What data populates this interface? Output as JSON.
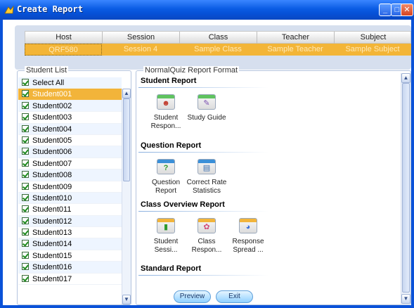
{
  "window": {
    "title": "Create Report",
    "minimize": "_",
    "maximize": "□",
    "close": "✕"
  },
  "header": {
    "columns": [
      "Host",
      "Session",
      "Class",
      "Teacher",
      "Subject"
    ],
    "values": [
      "QRF580",
      "Session 4",
      "Sample Class",
      "Sample Teacher",
      "Sample Subject"
    ]
  },
  "student_list": {
    "legend": "Student List",
    "select_all": "Select All",
    "students": [
      "Student001",
      "Student002",
      "Student003",
      "Student004",
      "Student005",
      "Student006",
      "Student007",
      "Student008",
      "Student009",
      "Student010",
      "Student011",
      "Student012",
      "Student013",
      "Student014",
      "Student015",
      "Student016",
      "Student017"
    ],
    "selected_index": 0
  },
  "report_format": {
    "legend": "NormalQuiz Report Format",
    "sections": [
      {
        "title": "Student Report",
        "items": [
          {
            "label": "Student Respon...",
            "icon": "student-response-icon",
            "glyph": "☻",
            "band": "#5fc35f",
            "color": "#c0392b"
          },
          {
            "label": "Study Guide",
            "icon": "study-guide-icon",
            "glyph": "✎",
            "band": "#5fc35f",
            "color": "#7a4fb0"
          }
        ]
      },
      {
        "title": "Question Report",
        "items": [
          {
            "label": "Question Report",
            "icon": "question-report-icon",
            "glyph": "?",
            "band": "#3a8fd8",
            "color": "#2f9a2f"
          },
          {
            "label": "Correct Rate Statistics",
            "icon": "correct-rate-icon",
            "glyph": "▤",
            "band": "#3a8fd8",
            "color": "#3a6fb0"
          }
        ]
      },
      {
        "title": "Class Overview Report",
        "items": [
          {
            "label": "Student Sessi...",
            "icon": "student-session-icon",
            "glyph": "▮",
            "band": "#f2b43a",
            "color": "#2f9a2f"
          },
          {
            "label": "Class Respon...",
            "icon": "class-response-icon",
            "glyph": "✿",
            "band": "#f2b43a",
            "color": "#d24c7a"
          },
          {
            "label": "Response Spread ...",
            "icon": "response-spread-icon",
            "glyph": "◕",
            "band": "#f2b43a",
            "color": "#3a6fd8"
          }
        ]
      },
      {
        "title": "Standard Report",
        "items": []
      }
    ]
  },
  "buttons": {
    "preview": "Preview",
    "exit": "Exit"
  }
}
